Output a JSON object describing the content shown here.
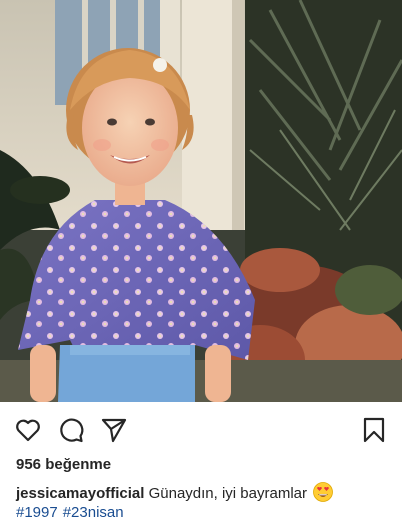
{
  "post": {
    "likes_text": "956 beğenme",
    "username": "jessicamayofficial",
    "caption_text": "Günaydın, iyi bayramlar",
    "caption_emoji": "smiling-face-with-heart-eyes",
    "hashtags": [
      "#1997",
      "#23nisan"
    ]
  },
  "icons": {
    "like": "heart-icon",
    "comment": "comment-bubble-icon",
    "share": "paper-plane-icon",
    "save": "bookmark-icon"
  },
  "colors": {
    "text": "#262626",
    "hashtag": "#1a4d91",
    "shirt": "#6c63b7",
    "pants": "#6f9fd0"
  }
}
